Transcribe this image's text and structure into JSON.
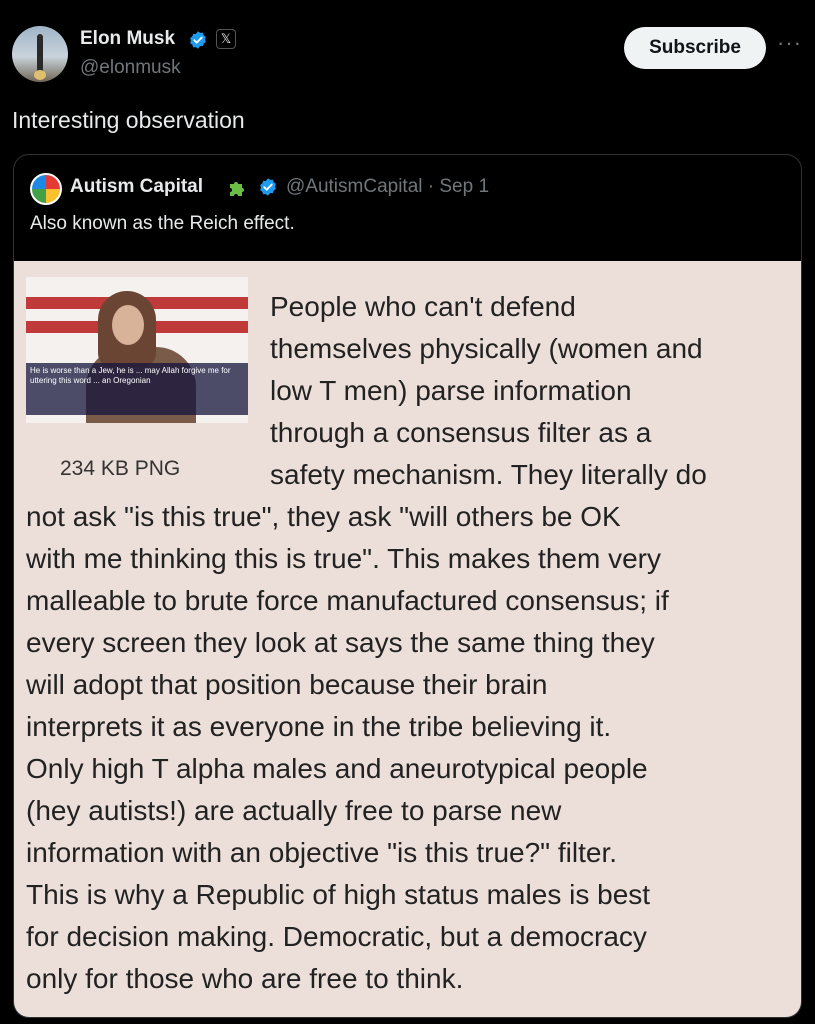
{
  "post": {
    "author_name": "Elon Musk",
    "handle": "@elonmusk",
    "x_badge": "𝕏",
    "subscribe_label": "Subscribe",
    "more_label": "···",
    "text": "Interesting observation"
  },
  "quote": {
    "author_name": "Autism Capital",
    "handle_date": "@AutismCapital · Sep 1",
    "text": "Also known as the Reich effect.",
    "image": {
      "thumbnail_caption": "He is worse than a Jew, he is ... may Allah forgive me for uttering this word ... an Oregonian",
      "file_label": "234 KB PNG",
      "lines": [
        "People who can't defend",
        "themselves physically (women and",
        "low T men) parse information",
        "through a consensus filter as a",
        "safety mechanism. They literally do",
        "not ask \"is this true\", they ask \"will others be OK",
        "with me thinking this is true\". This makes them very",
        "malleable to brute force manufactured consensus; if",
        "every screen they look at says the same thing they",
        "will adopt that position because their brain",
        "interprets it as everyone in the tribe believing it.",
        "Only high T alpha males and aneurotypical people",
        "(hey autists!) are actually free to parse new",
        "information with an objective \"is this true?\" filter.",
        "This is why a Republic of high status males is best",
        "for decision making. Democratic, but a democracy",
        "only for those who are free to think."
      ]
    }
  },
  "colors": {
    "background": "#000000",
    "verified_blue": "#1d9bf0",
    "meme_background": "#ecdfd9"
  },
  "icons": [
    "verified-badge-icon",
    "x-logo-icon",
    "puzzle-piece-icon",
    "more-options-icon"
  ]
}
